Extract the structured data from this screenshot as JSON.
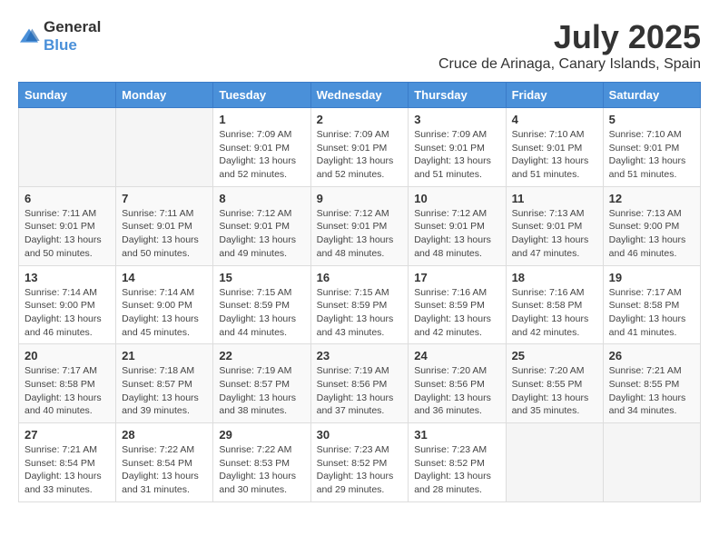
{
  "logo": {
    "general": "General",
    "blue": "Blue"
  },
  "title": "July 2025",
  "location": "Cruce de Arinaga, Canary Islands, Spain",
  "days_header": [
    "Sunday",
    "Monday",
    "Tuesday",
    "Wednesday",
    "Thursday",
    "Friday",
    "Saturday"
  ],
  "weeks": [
    [
      {
        "day": "",
        "info": ""
      },
      {
        "day": "",
        "info": ""
      },
      {
        "day": "1",
        "info": "Sunrise: 7:09 AM\nSunset: 9:01 PM\nDaylight: 13 hours and 52 minutes."
      },
      {
        "day": "2",
        "info": "Sunrise: 7:09 AM\nSunset: 9:01 PM\nDaylight: 13 hours and 52 minutes."
      },
      {
        "day": "3",
        "info": "Sunrise: 7:09 AM\nSunset: 9:01 PM\nDaylight: 13 hours and 51 minutes."
      },
      {
        "day": "4",
        "info": "Sunrise: 7:10 AM\nSunset: 9:01 PM\nDaylight: 13 hours and 51 minutes."
      },
      {
        "day": "5",
        "info": "Sunrise: 7:10 AM\nSunset: 9:01 PM\nDaylight: 13 hours and 51 minutes."
      }
    ],
    [
      {
        "day": "6",
        "info": "Sunrise: 7:11 AM\nSunset: 9:01 PM\nDaylight: 13 hours and 50 minutes."
      },
      {
        "day": "7",
        "info": "Sunrise: 7:11 AM\nSunset: 9:01 PM\nDaylight: 13 hours and 50 minutes."
      },
      {
        "day": "8",
        "info": "Sunrise: 7:12 AM\nSunset: 9:01 PM\nDaylight: 13 hours and 49 minutes."
      },
      {
        "day": "9",
        "info": "Sunrise: 7:12 AM\nSunset: 9:01 PM\nDaylight: 13 hours and 48 minutes."
      },
      {
        "day": "10",
        "info": "Sunrise: 7:12 AM\nSunset: 9:01 PM\nDaylight: 13 hours and 48 minutes."
      },
      {
        "day": "11",
        "info": "Sunrise: 7:13 AM\nSunset: 9:01 PM\nDaylight: 13 hours and 47 minutes."
      },
      {
        "day": "12",
        "info": "Sunrise: 7:13 AM\nSunset: 9:00 PM\nDaylight: 13 hours and 46 minutes."
      }
    ],
    [
      {
        "day": "13",
        "info": "Sunrise: 7:14 AM\nSunset: 9:00 PM\nDaylight: 13 hours and 46 minutes."
      },
      {
        "day": "14",
        "info": "Sunrise: 7:14 AM\nSunset: 9:00 PM\nDaylight: 13 hours and 45 minutes."
      },
      {
        "day": "15",
        "info": "Sunrise: 7:15 AM\nSunset: 8:59 PM\nDaylight: 13 hours and 44 minutes."
      },
      {
        "day": "16",
        "info": "Sunrise: 7:15 AM\nSunset: 8:59 PM\nDaylight: 13 hours and 43 minutes."
      },
      {
        "day": "17",
        "info": "Sunrise: 7:16 AM\nSunset: 8:59 PM\nDaylight: 13 hours and 42 minutes."
      },
      {
        "day": "18",
        "info": "Sunrise: 7:16 AM\nSunset: 8:58 PM\nDaylight: 13 hours and 42 minutes."
      },
      {
        "day": "19",
        "info": "Sunrise: 7:17 AM\nSunset: 8:58 PM\nDaylight: 13 hours and 41 minutes."
      }
    ],
    [
      {
        "day": "20",
        "info": "Sunrise: 7:17 AM\nSunset: 8:58 PM\nDaylight: 13 hours and 40 minutes."
      },
      {
        "day": "21",
        "info": "Sunrise: 7:18 AM\nSunset: 8:57 PM\nDaylight: 13 hours and 39 minutes."
      },
      {
        "day": "22",
        "info": "Sunrise: 7:19 AM\nSunset: 8:57 PM\nDaylight: 13 hours and 38 minutes."
      },
      {
        "day": "23",
        "info": "Sunrise: 7:19 AM\nSunset: 8:56 PM\nDaylight: 13 hours and 37 minutes."
      },
      {
        "day": "24",
        "info": "Sunrise: 7:20 AM\nSunset: 8:56 PM\nDaylight: 13 hours and 36 minutes."
      },
      {
        "day": "25",
        "info": "Sunrise: 7:20 AM\nSunset: 8:55 PM\nDaylight: 13 hours and 35 minutes."
      },
      {
        "day": "26",
        "info": "Sunrise: 7:21 AM\nSunset: 8:55 PM\nDaylight: 13 hours and 34 minutes."
      }
    ],
    [
      {
        "day": "27",
        "info": "Sunrise: 7:21 AM\nSunset: 8:54 PM\nDaylight: 13 hours and 33 minutes."
      },
      {
        "day": "28",
        "info": "Sunrise: 7:22 AM\nSunset: 8:54 PM\nDaylight: 13 hours and 31 minutes."
      },
      {
        "day": "29",
        "info": "Sunrise: 7:22 AM\nSunset: 8:53 PM\nDaylight: 13 hours and 30 minutes."
      },
      {
        "day": "30",
        "info": "Sunrise: 7:23 AM\nSunset: 8:52 PM\nDaylight: 13 hours and 29 minutes."
      },
      {
        "day": "31",
        "info": "Sunrise: 7:23 AM\nSunset: 8:52 PM\nDaylight: 13 hours and 28 minutes."
      },
      {
        "day": "",
        "info": ""
      },
      {
        "day": "",
        "info": ""
      }
    ]
  ]
}
